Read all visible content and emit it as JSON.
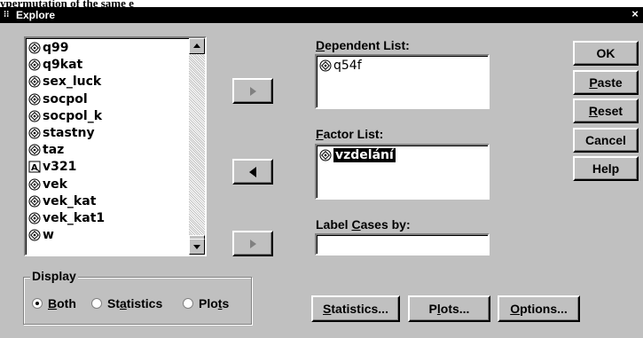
{
  "caption_text": "ypermutation of the same e",
  "window": {
    "title": "Explore",
    "close_glyph": "×"
  },
  "variables": {
    "items": [
      {
        "name": "q99",
        "icon": "scale-var-icon"
      },
      {
        "name": "q9kat",
        "icon": "scale-var-icon"
      },
      {
        "name": "sex_luck",
        "icon": "scale-var-icon"
      },
      {
        "name": "socpol",
        "icon": "scale-var-icon"
      },
      {
        "name": "socpol_k",
        "icon": "scale-var-icon"
      },
      {
        "name": "stastny",
        "icon": "scale-var-icon"
      },
      {
        "name": "taz",
        "icon": "scale-var-icon"
      },
      {
        "name": "v321",
        "icon": "string-var-icon"
      },
      {
        "name": "vek",
        "icon": "scale-var-icon"
      },
      {
        "name": "vek_kat",
        "icon": "scale-var-icon"
      },
      {
        "name": "vek_kat1",
        "icon": "scale-var-icon"
      },
      {
        "name": "w",
        "icon": "scale-var-icon"
      }
    ]
  },
  "dependent": {
    "label": "Dependent List:",
    "items": [
      "q54f"
    ]
  },
  "factor": {
    "label": "Factor List:",
    "items": [
      "vzdelání"
    ]
  },
  "label_cases": {
    "label": "Label Cases by:",
    "value": ""
  },
  "buttons": {
    "ok": "OK",
    "paste": "Paste",
    "reset": "Reset",
    "cancel": "Cancel",
    "help": "Help",
    "statistics": "Statistics...",
    "plots": "Plots...",
    "options": "Options..."
  },
  "display": {
    "label": "Display",
    "options": [
      "Both",
      "Statistics",
      "Plots"
    ],
    "selected": "Both"
  },
  "colors": {
    "dialog_bg": "#c0c0c0",
    "titlebar_bg": "#000000",
    "list_bg": "#ffffff"
  }
}
